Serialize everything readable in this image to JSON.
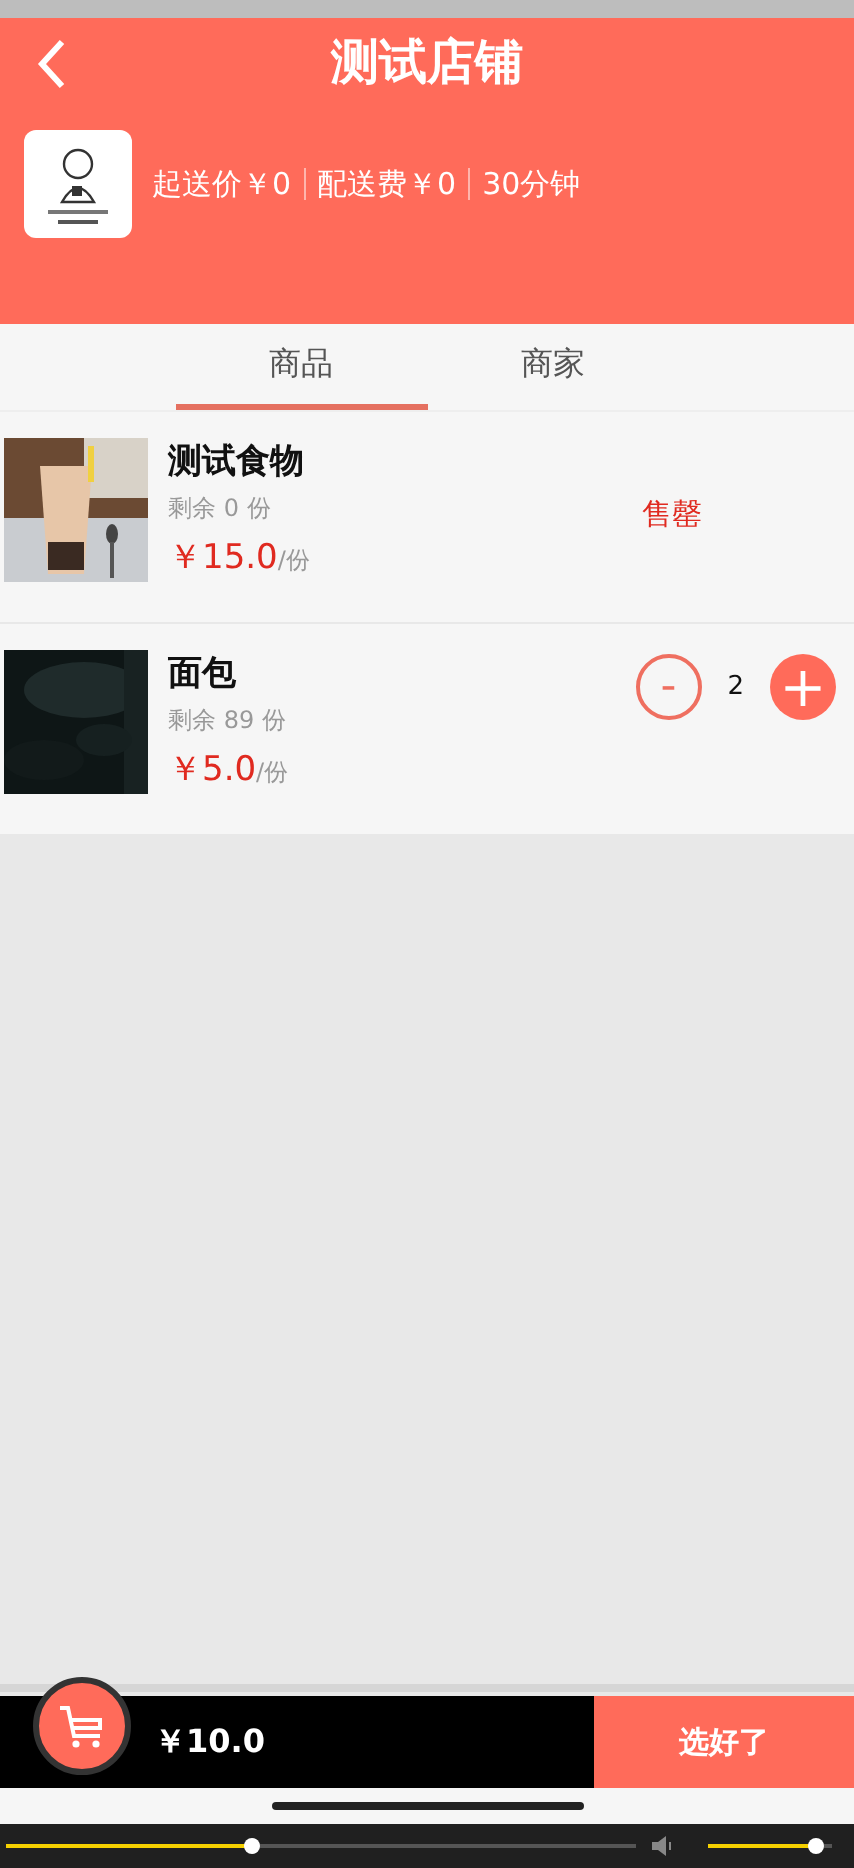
{
  "header": {
    "title": "测试店铺",
    "min_order": "起送价￥0",
    "delivery_fee": "配送费￥0",
    "delivery_time": "30分钟"
  },
  "tabs": [
    {
      "label": "商品",
      "selected": true
    },
    {
      "label": "商家",
      "selected": false
    }
  ],
  "products": [
    {
      "name": "测试食物",
      "stock": "剩余 0 份",
      "price": "￥15.0",
      "unit": "/份",
      "kind": "sold_out",
      "status": "售罄"
    },
    {
      "name": "面包",
      "stock": "剩余 89 份",
      "price": "￥5.0",
      "unit": "/份",
      "kind": "stepper",
      "minus": "-",
      "quantity": "2",
      "plus": "+"
    }
  ],
  "cart": {
    "total": "￥10.0",
    "checkout": "选好了"
  },
  "player": {
    "progress": {
      "level": 0.39
    },
    "volume": {
      "level": 0.87
    }
  }
}
